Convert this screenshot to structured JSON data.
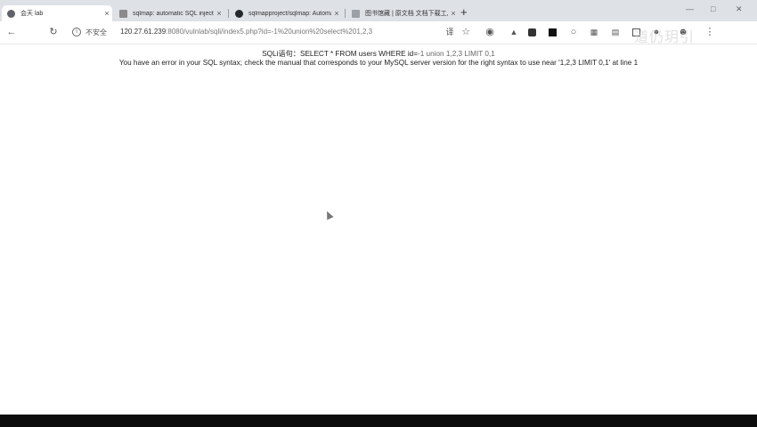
{
  "browser": {
    "tabs": [
      {
        "title": "会天 lab",
        "active": true,
        "icon": "page-icon"
      },
      {
        "title": "sqlmap: automatic SQL injectio",
        "active": false,
        "icon": "sqlmap-icon"
      },
      {
        "title": "sqlmapproject/sqlmap: Automa",
        "active": false,
        "icon": "github-icon"
      },
      {
        "title": "图书馆藏 | 原文档 文档下载工具",
        "active": false,
        "icon": "doc-icon"
      }
    ],
    "close_glyph": "×",
    "new_tab_glyph": "+",
    "security_label": "不安全",
    "url_host": "120.27.61.239",
    "url_path": ":8080/vulnlab/sqli/index5.php?id=-1%20union%20select%201,2,3",
    "watermark": "道仍玥引"
  },
  "page": {
    "sql_label": "SQLi语句：",
    "sql_query": "SELECT * FROM users WHERE id=",
    "sql_suffix": "-1 union 1,2,3 LIMIT 0,1",
    "error_message": "You have an error in your SQL syntax; check the manual that corresponds to your MySQL server version for the right syntax to use near '1,2,3 LIMIT 0,1' at line 1"
  },
  "colors": {
    "tab_bar": "#dee1e6",
    "taskbar": "#0c0c0c"
  }
}
